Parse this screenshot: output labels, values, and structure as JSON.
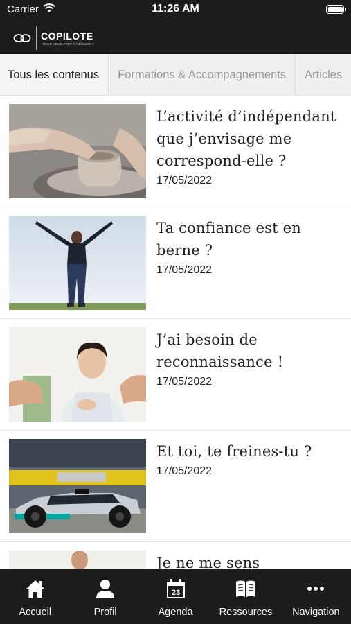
{
  "status_bar": {
    "carrier": "Carrier",
    "time": "11:26 AM"
  },
  "header": {
    "brand": "COPILOTE",
    "tagline": "• ÊTES-VOUS PRÊT À RÉUSSIR ?"
  },
  "tabs": [
    {
      "label": "Tous les contenus",
      "active": true
    },
    {
      "label": "Formations & Accompagnements",
      "active": false
    },
    {
      "label": "Articles",
      "active": false
    }
  ],
  "items": [
    {
      "title": "L’activité d’indépendant que j’envisage me correspond-elle ?",
      "date": "17/05/2022",
      "image": "pottery-hands"
    },
    {
      "title": "Ta confiance est en berne ?",
      "date": "17/05/2022",
      "image": "woman-arms-raised"
    },
    {
      "title": "J’ai besoin de reconnaissance !",
      "date": "17/05/2022",
      "image": "woman-applause"
    },
    {
      "title": "Et toi, te freines-tu ?",
      "date": "17/05/2022",
      "image": "formula-one-car"
    },
    {
      "title": "Je ne me sens",
      "date": "",
      "image": "person-portrait"
    }
  ],
  "nav": [
    {
      "label": "Accueil",
      "icon": "home-icon"
    },
    {
      "label": "Profil",
      "icon": "person-icon"
    },
    {
      "label": "Agenda",
      "icon": "calendar-icon",
      "badge": "23"
    },
    {
      "label": "Ressources",
      "icon": "book-icon"
    },
    {
      "label": "Navigation",
      "icon": "more-icon"
    }
  ]
}
